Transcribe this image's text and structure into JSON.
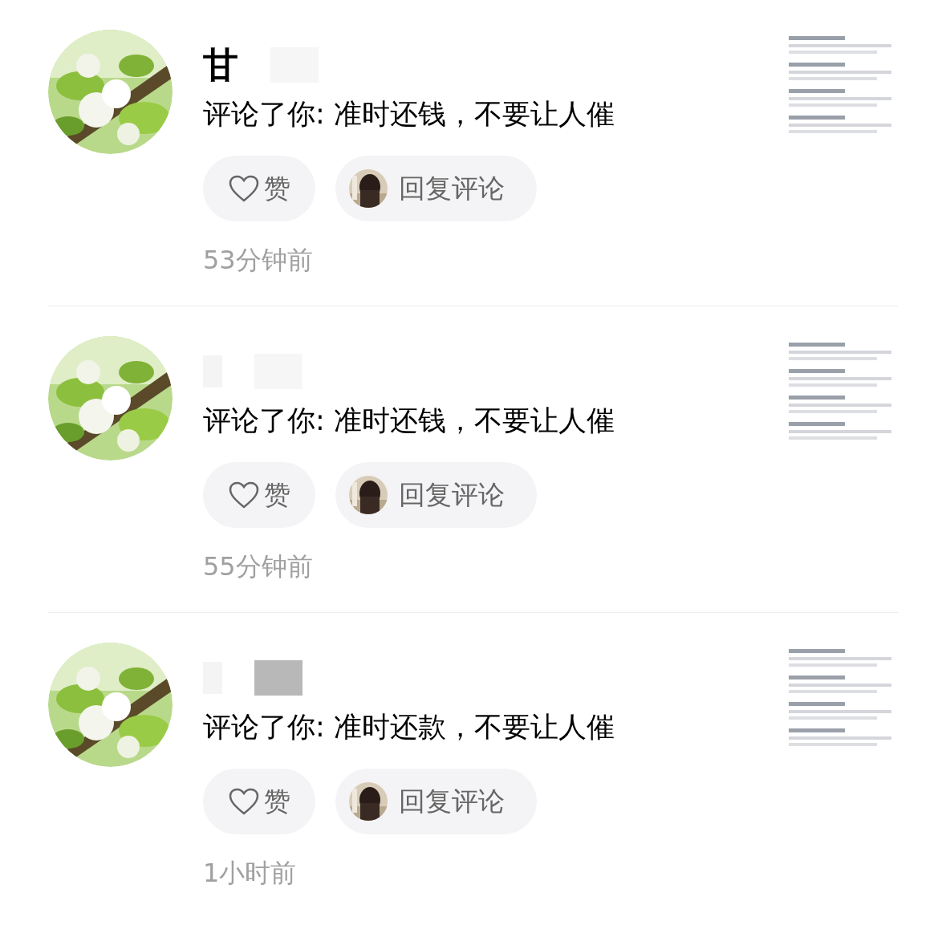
{
  "notifications": [
    {
      "name": "甘",
      "comment": "评论了你: 准时还钱，不要让人催",
      "like_label": "赞",
      "reply_label": "回复评论",
      "time": "53分钟前"
    },
    {
      "comment": "评论了你: 准时还钱，不要让人催",
      "like_label": "赞",
      "reply_label": "回复评论",
      "time": "55分钟前"
    },
    {
      "comment": "评论了你: 准时还款，不要让人催",
      "like_label": "赞",
      "reply_label": "回复评论",
      "time": "1小时前"
    }
  ]
}
